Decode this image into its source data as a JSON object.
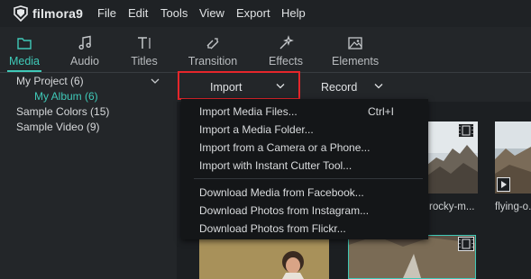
{
  "app": {
    "logo_text": "filmora9"
  },
  "menubar": {
    "items": [
      "File",
      "Edit",
      "Tools",
      "View",
      "Export",
      "Help"
    ]
  },
  "tabs": [
    {
      "label": "Media",
      "icon": "folder-icon",
      "active": true
    },
    {
      "label": "Audio",
      "icon": "music-note-icon",
      "active": false
    },
    {
      "label": "Titles",
      "icon": "text-icon",
      "active": false
    },
    {
      "label": "Transition",
      "icon": "transition-icon",
      "active": false
    },
    {
      "label": "Effects",
      "icon": "effects-sparkle-icon",
      "active": false
    },
    {
      "label": "Elements",
      "icon": "image-icon",
      "active": false
    }
  ],
  "sidebar": {
    "items": [
      {
        "label": "My Project (6)"
      },
      {
        "label": "My Album (6)"
      },
      {
        "label": "Sample Colors (15)"
      },
      {
        "label": "Sample Video (9)"
      }
    ]
  },
  "toolbar": {
    "import_label": "Import",
    "record_label": "Record"
  },
  "import_menu": {
    "items": [
      {
        "label": "Import Media Files...",
        "shortcut": "Ctrl+I"
      },
      {
        "label": "Import a Media Folder..."
      },
      {
        "label": "Import from a Camera or a Phone..."
      },
      {
        "label": "Import with Instant Cutter Tool..."
      },
      {
        "label": "Download Media from Facebook..."
      },
      {
        "label": "Download Photos from Instagram..."
      },
      {
        "label": "Download Photos from Flickr..."
      }
    ]
  },
  "thumbnails": [
    {
      "label": "rocky-m..."
    },
    {
      "label": "flying-o..."
    }
  ],
  "colors": {
    "accent": "#3fc9b8",
    "highlight": "#e5262b"
  }
}
